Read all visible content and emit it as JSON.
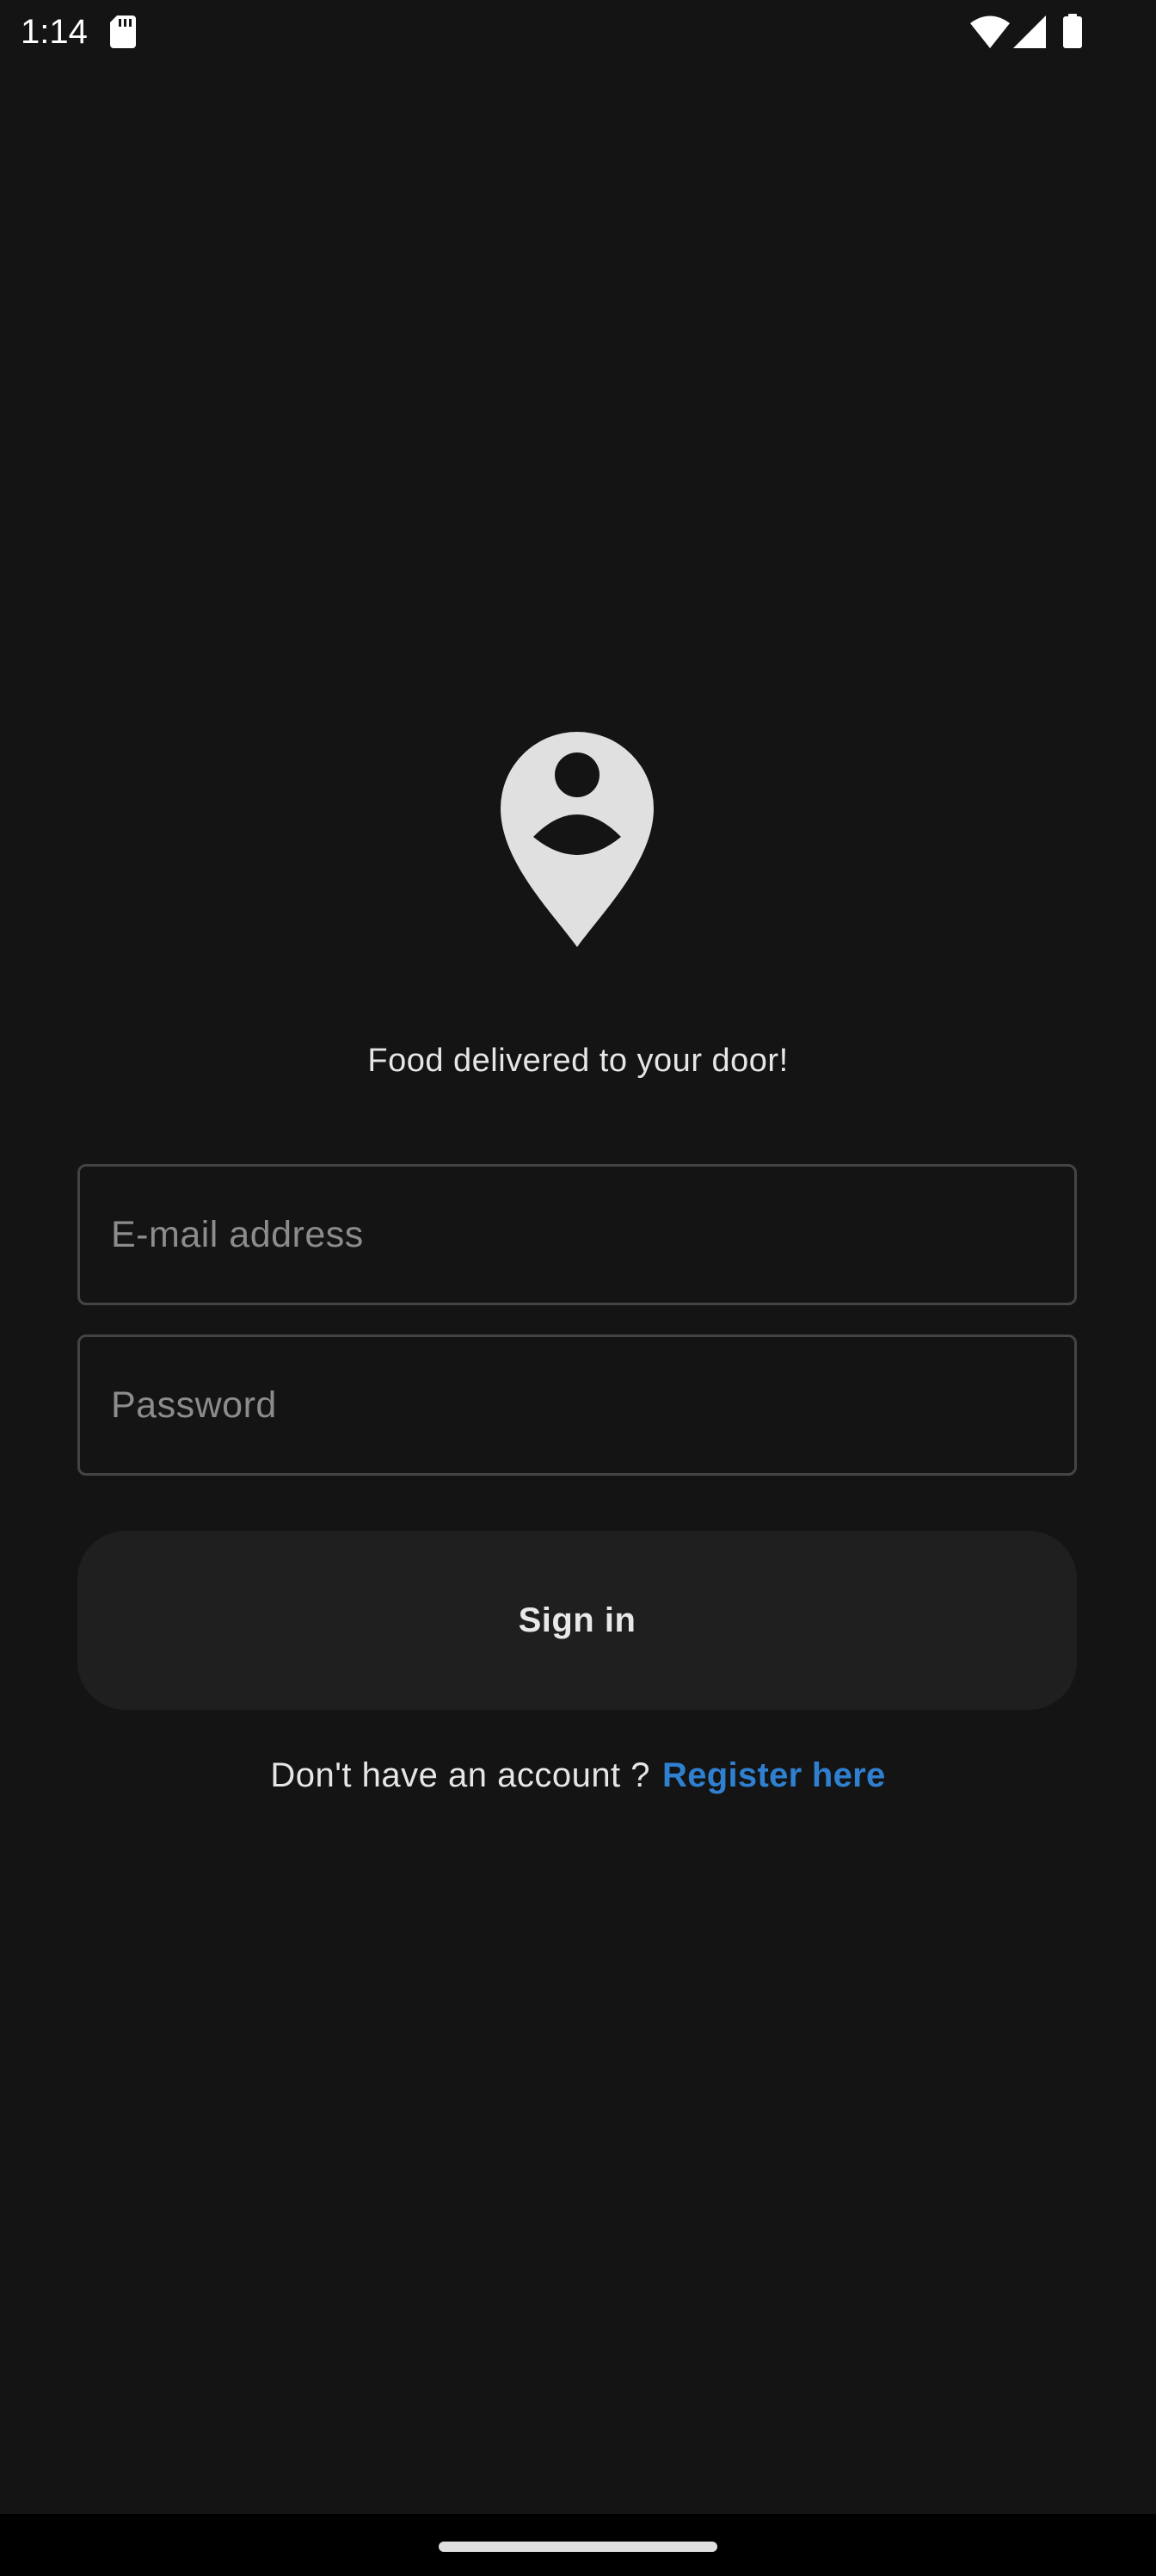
{
  "status_bar": {
    "time": "1:14",
    "icons": [
      "sd-card-icon",
      "wifi-icon",
      "signal-icon",
      "battery-icon"
    ]
  },
  "logo": {
    "icon": "location-person-icon",
    "color": "#e0e0e0"
  },
  "tagline": "Food delivered to your door!",
  "form": {
    "email_placeholder": "E-mail address",
    "email_value": "",
    "password_placeholder": "Password",
    "password_value": "",
    "sign_in_label": "Sign in"
  },
  "register": {
    "prompt": "Don't have an account ?",
    "link_label": "Register here"
  },
  "colors": {
    "background": "#141414",
    "accent_link": "#2f80d0",
    "button_bg": "#1f1f1f"
  }
}
